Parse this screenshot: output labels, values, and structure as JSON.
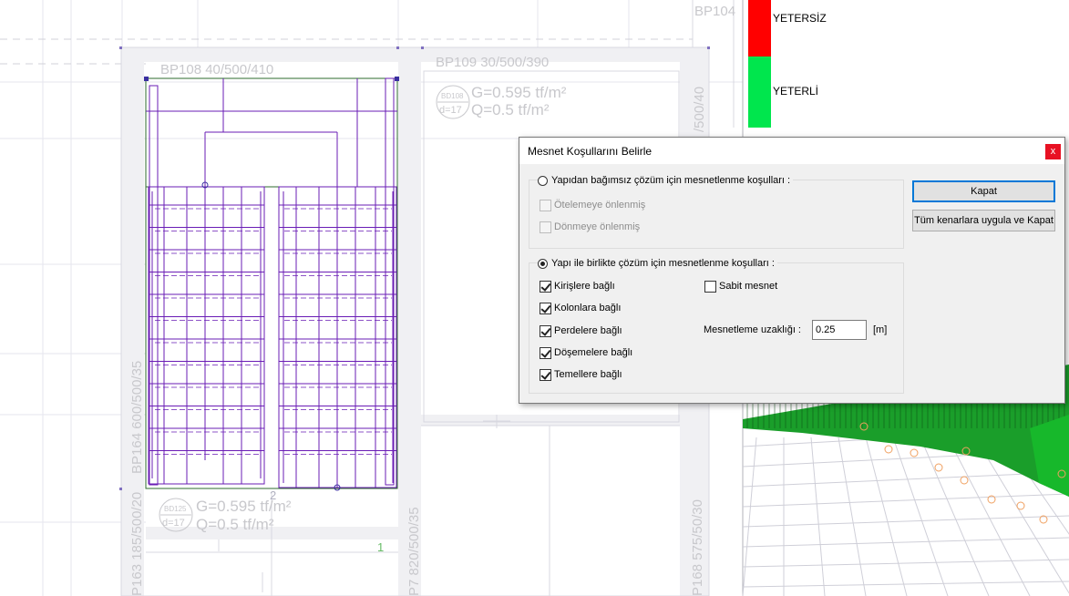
{
  "cad": {
    "beams": {
      "top_left": "BP108 40/500/410",
      "top_right": "BP109 30/500/390",
      "top_far": "BP104",
      "left_vertical": "BP164 600/500/35",
      "bottom_left": "P163 185/500/20",
      "bottom_mid": "P7 820/500/35",
      "right_vertical_1": "/500/40",
      "right_vertical_2": "P168 575/50/30"
    },
    "slabs": {
      "upper": {
        "badge_id": "BD108",
        "badge_d": "d=17",
        "load_g": "G=0.595 tf/m²",
        "load_q": "Q=0.5 tf/m²"
      },
      "lower": {
        "badge_id": "BD125",
        "badge_d": "d=17",
        "load_g": "G=0.595 tf/m²",
        "load_q": "Q=0.5 tf/m²"
      }
    },
    "markers": {
      "num_1": "1",
      "num_2": "2"
    }
  },
  "legend": {
    "items": [
      {
        "label": "YETERSİZ",
        "color": "#ff0000"
      },
      {
        "label": "YETERLİ",
        "color": "#00e64d"
      }
    ]
  },
  "dialog": {
    "title": "Mesnet Koşullarını Belirle",
    "close_glyph": "x",
    "independent": {
      "label": "Yapıdan bağımsız çözüm için mesnetlenme koşulları  :",
      "selected": false,
      "opt_translation": "Ötelemeye önlenmiş",
      "opt_rotation": "Dönmeye önlenmiş"
    },
    "combined": {
      "label": "Yapı ile birlikte çözüm için mesnetlenme koşulları  :",
      "selected": true,
      "beams": "Kirişlere bağlı",
      "columns": "Kolonlara bağlı",
      "walls": "Perdelere bağlı",
      "slabs": "Döşemelere bağlı",
      "foundations": "Temellere bağlı",
      "fixed": "Sabit mesnet",
      "distance_label": "Mesnetleme uzaklığı  :",
      "distance_value": "0.25",
      "distance_unit": "[m]"
    },
    "buttons": {
      "close": "Kapat",
      "apply_all": "Tüm kenarlara uygula ve Kapat"
    }
  }
}
